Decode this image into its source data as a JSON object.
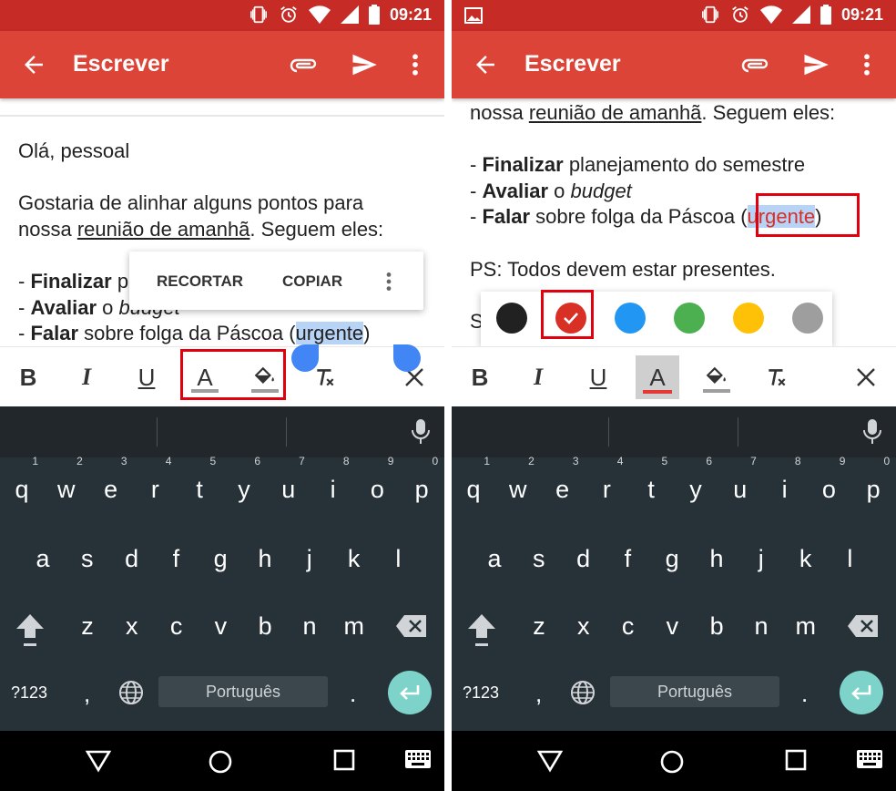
{
  "left": {
    "status": {
      "time": "09:21"
    },
    "appbar": {
      "title": "Escrever"
    },
    "body": {
      "greeting": "Olá, pessoal",
      "line1": "Gostaria de alinhar alguns pontos para",
      "line2_a": "nossa ",
      "line2_u": "reunião de amanhã",
      "line2_b": ". Seguem eles:",
      "item1_dash": "- ",
      "item1_bold": "Finalizar",
      "item1_rest": " p",
      "item2_dash": "- ",
      "item2_bold": "Avaliar",
      "item2_rest": " o ",
      "item2_italic": "budget",
      "item3_dash": "- ",
      "item3_bold": "Falar",
      "item3_rest": " sobre folga da Páscoa (",
      "item3_hl": "urgente",
      "item3_end": ")"
    },
    "context_menu": {
      "cut": "RECORTAR",
      "copy": "COPIAR"
    },
    "toolbar": {
      "bold": "B",
      "italic": "I",
      "underline": "U",
      "text_color": "A"
    },
    "keyboard": {
      "row1": [
        [
          "q",
          "1"
        ],
        [
          "w",
          "2"
        ],
        [
          "e",
          "3"
        ],
        [
          "r",
          "4"
        ],
        [
          "t",
          "5"
        ],
        [
          "y",
          "6"
        ],
        [
          "u",
          "7"
        ],
        [
          "i",
          "8"
        ],
        [
          "o",
          "9"
        ],
        [
          "p",
          "0"
        ]
      ],
      "row2": [
        "a",
        "s",
        "d",
        "f",
        "g",
        "h",
        "j",
        "k",
        "l"
      ],
      "row3": [
        "z",
        "x",
        "c",
        "v",
        "b",
        "n",
        "m"
      ],
      "sym": "?123",
      "comma": ",",
      "space": "Português",
      "period": "."
    }
  },
  "right": {
    "status": {
      "time": "09:21"
    },
    "appbar": {
      "title": "Escrever"
    },
    "body": {
      "line2_a": "nossa ",
      "line2_u": "reunião de amanhã",
      "line2_b": ". Seguem eles:",
      "item1_dash": "- ",
      "item1_bold": "Finalizar",
      "item1_rest": " planejamento do semestre",
      "item2_dash": "- ",
      "item2_bold": "Avaliar",
      "item2_rest": " o ",
      "item2_italic": "budget",
      "item3_dash": "- ",
      "item3_bold": "Falar",
      "item3_rest": " sobre folga da Páscoa (",
      "item3_hl": "urgente",
      "item3_end": ")",
      "ps": "PS: Todos devem estar presentes.",
      "partial": "S"
    },
    "palette": [
      {
        "name": "black",
        "color": "#212121"
      },
      {
        "name": "red",
        "color": "#d93025",
        "selected": true
      },
      {
        "name": "blue",
        "color": "#2196f3"
      },
      {
        "name": "green",
        "color": "#4caf50"
      },
      {
        "name": "yellow",
        "color": "#ffc107"
      },
      {
        "name": "gray",
        "color": "#9e9e9e"
      }
    ],
    "toolbar": {
      "bold": "B",
      "italic": "I",
      "underline": "U",
      "text_color": "A"
    },
    "keyboard": {
      "sym": "?123",
      "comma": ",",
      "space": "Português",
      "period": "."
    }
  },
  "colors": {
    "statusbar": "#c62b26",
    "appbar": "#db4437",
    "selection": "#b7d3f6",
    "keyboard": "#263238",
    "enter_key": "#7dd3c9",
    "highlight_box": "#e0000e"
  }
}
